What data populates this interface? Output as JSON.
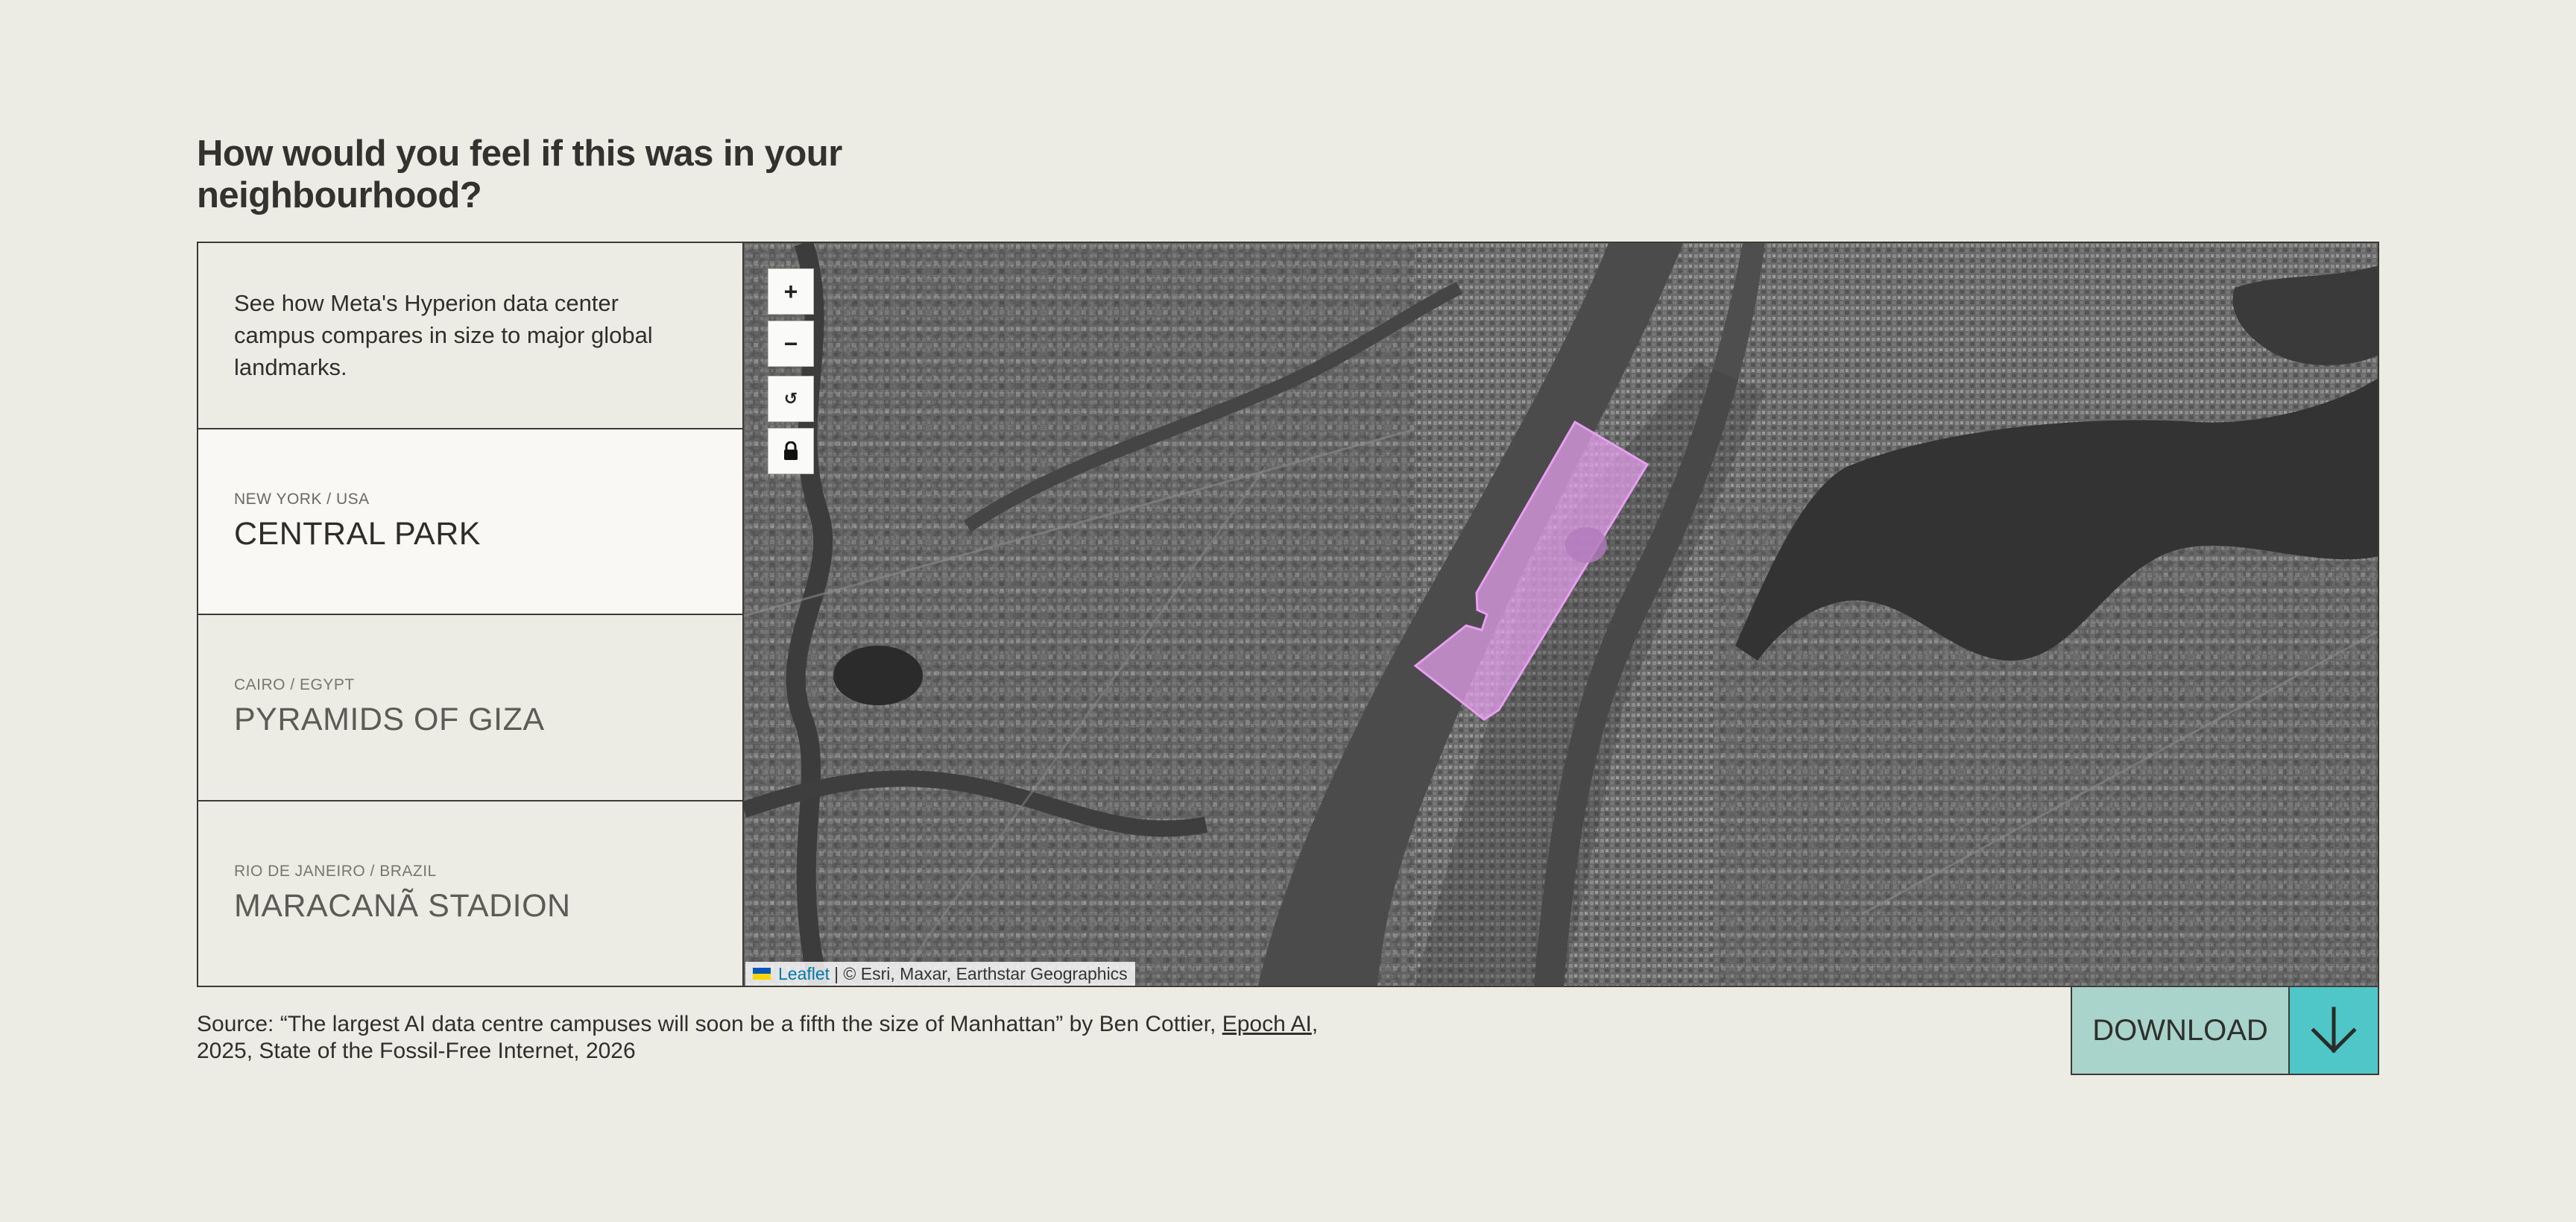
{
  "heading": "How would you feel if this was in your neighbourhood?",
  "intro": "See how Meta's Hyperion data center campus compares in size to major global landmarks.",
  "landmarks": [
    {
      "location": "NEW YORK / USA",
      "name": "CENTRAL PARK",
      "active": true
    },
    {
      "location": "CAIRO / EGYPT",
      "name": "PYRAMIDS OF GIZA",
      "active": false
    },
    {
      "location": "RIO DE JANEIRO / BRAZIL",
      "name": "MARACANÃ STADION",
      "active": false
    }
  ],
  "map": {
    "controls": {
      "zoom_in": "+",
      "zoom_out": "−",
      "reset": "↺",
      "lock": "lock-icon"
    },
    "attribution": {
      "link": "Leaflet",
      "text": "| © Esri, Maxar, Earthstar Geographics"
    },
    "overlay_color": "#e79ff0"
  },
  "source": {
    "prefix": "Source: “The largest AI data centre campuses will soon be a fifth the size of Manhattan” by Ben Cottier,",
    "link": "Epoch AI",
    "suffix": ", 2025, State of the Fossil-Free Internet, 2026"
  },
  "download": {
    "label": "DOWNLOAD",
    "icon": "arrow-down-icon"
  },
  "colors": {
    "background": "#ecebe4",
    "download_label_bg": "#a9d4cb",
    "download_arrow_bg": "#4fc6c7"
  }
}
